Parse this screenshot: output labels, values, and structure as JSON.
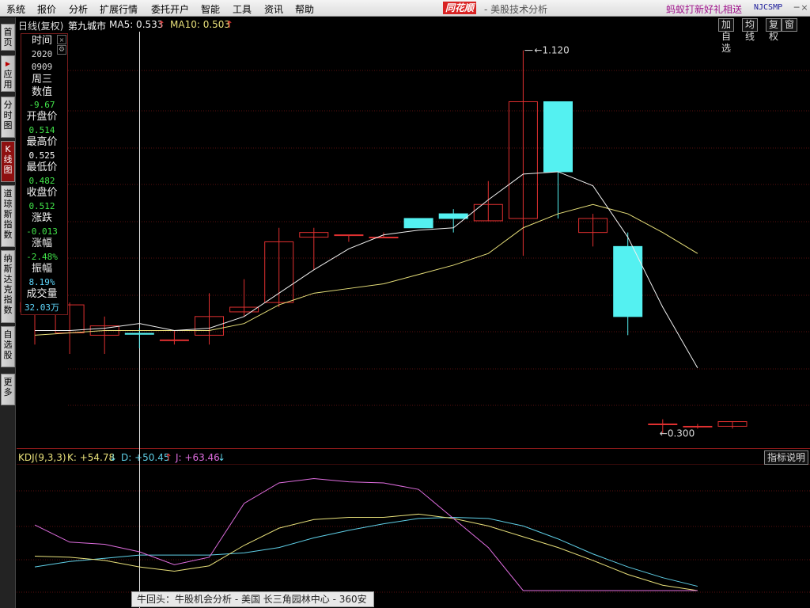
{
  "menu": [
    "系统",
    "报价",
    "分析",
    "扩展行情",
    "委托开户",
    "智能",
    "工具",
    "资讯",
    "帮助"
  ],
  "brand": {
    "logo_text": "同花顺",
    "title": "- 美股技术分析",
    "promo": "蚂蚁打新好礼相送",
    "user_id": "NJCSMP"
  },
  "window_buttons": [
    "─",
    "□",
    "×"
  ],
  "side_tabs": [
    {
      "label": "首页"
    },
    {
      "label": "应用"
    },
    {
      "label": "分时图"
    },
    {
      "label": "K线图"
    },
    {
      "label": "道琼斯指数"
    },
    {
      "label": "纳斯达克指数"
    },
    {
      "label": "自选股"
    },
    {
      "label": "更多"
    }
  ],
  "header": {
    "period": "日线(复权)",
    "stock_name": "第九城市",
    "ma5_label": "MA5: 0.533",
    "ma5_dir": "↑",
    "ma10_label": "MA10: 0.503",
    "ma10_dir": "↑",
    "buttons": [
      "加自选",
      "均线",
      "复权",
      "窗"
    ]
  },
  "info": {
    "time_label": "时间",
    "year": "2020",
    "date": "0909",
    "weekday": "周三",
    "value_label": "数值",
    "value": "-9.67",
    "open_label": "开盘价",
    "open": "0.514",
    "high_label": "最高价",
    "high": "0.525",
    "low_label": "最低价",
    "low": "0.482",
    "close_label": "收盘价",
    "close": "0.512",
    "change_label": "涨跌",
    "change": "-0.013",
    "pct_label": "涨幅",
    "pct": "-2.48%",
    "amp_label": "振幅",
    "amp": "8.19%",
    "vol_label": "成交量",
    "vol": "32.03万",
    "close_icon": "×",
    "gear_icon": "⚙"
  },
  "annotations": {
    "max_label": "1.120",
    "min_label": "0.300"
  },
  "kdj": {
    "name": "KDJ(9,3,3)",
    "k_label": "K: +54.78",
    "k_dir": "↓",
    "d_label": "D: +50.45",
    "d_dir": "↑",
    "j_label": "J: +63.46",
    "j_dir": "↓",
    "button": "指标说明"
  },
  "ticker": "牛回头：牛股机会分析 - 美国 长三角园林中心 - 360安",
  "colors": {
    "up": "#e03030",
    "down": "#54f1f1",
    "ma5": "#f0f0f0",
    "ma10": "#e8e07a",
    "k": "#e8e07a",
    "d": "#5fd0e8",
    "j": "#e06ee0",
    "grid": "#5a1010"
  },
  "chart_data": {
    "type": "candlestick",
    "price_ylim": [
      0.27,
      1.16
    ],
    "candles": [
      {
        "o": 0.56,
        "h": 0.6,
        "l": 0.49,
        "c": 0.58
      },
      {
        "o": 0.515,
        "h": 0.58,
        "l": 0.47,
        "c": 0.575
      },
      {
        "o": 0.51,
        "h": 0.55,
        "l": 0.47,
        "c": 0.53
      },
      {
        "o": 0.514,
        "h": 0.525,
        "l": 0.482,
        "c": 0.512
      },
      {
        "o": 0.5,
        "h": 0.52,
        "l": 0.49,
        "c": 0.5
      },
      {
        "o": 0.51,
        "h": 0.6,
        "l": 0.49,
        "c": 0.55
      },
      {
        "o": 0.56,
        "h": 0.63,
        "l": 0.55,
        "c": 0.57
      },
      {
        "o": 0.58,
        "h": 0.74,
        "l": 0.57,
        "c": 0.71
      },
      {
        "o": 0.72,
        "h": 0.74,
        "l": 0.65,
        "c": 0.73
      },
      {
        "o": 0.725,
        "h": 0.725,
        "l": 0.71,
        "c": 0.725
      },
      {
        "o": 0.72,
        "h": 0.73,
        "l": 0.72,
        "c": 0.72
      },
      {
        "o": 0.76,
        "h": 0.76,
        "l": 0.74,
        "c": 0.74
      },
      {
        "o": 0.77,
        "h": 0.78,
        "l": 0.73,
        "c": 0.76
      },
      {
        "o": 0.755,
        "h": 0.84,
        "l": 0.755,
        "c": 0.79
      },
      {
        "o": 0.76,
        "h": 1.12,
        "l": 0.68,
        "c": 1.01
      },
      {
        "o": 1.01,
        "h": 0.96,
        "l": 0.76,
        "c": 0.86
      },
      {
        "o": 0.73,
        "h": 0.77,
        "l": 0.7,
        "c": 0.76
      },
      {
        "o": 0.7,
        "h": 0.73,
        "l": 0.51,
        "c": 0.55
      },
      {
        "o": 0.32,
        "h": 0.33,
        "l": 0.3,
        "c": 0.32
      },
      {
        "o": 0.315,
        "h": 0.32,
        "l": 0.31,
        "c": 0.315
      },
      {
        "o": 0.315,
        "h": 0.325,
        "l": 0.31,
        "c": 0.325
      }
    ],
    "ma5": [
      0.52,
      0.52,
      0.525,
      0.535,
      0.52,
      0.525,
      0.55,
      0.6,
      0.65,
      0.695,
      0.725,
      0.735,
      0.74,
      0.8,
      0.855,
      0.86,
      0.83,
      0.72,
      0.57,
      0.44
    ],
    "ma10": [
      0.51,
      0.515,
      0.52,
      0.52,
      0.52,
      0.52,
      0.535,
      0.575,
      0.6,
      0.61,
      0.62,
      0.64,
      0.66,
      0.685,
      0.74,
      0.77,
      0.79,
      0.77,
      0.73,
      0.685
    ],
    "kdj_ylim": [
      0,
      100
    ],
    "k": [
      32,
      31,
      28,
      22,
      18,
      23,
      42,
      58,
      66,
      68,
      68,
      71,
      67,
      60,
      50,
      40,
      28,
      15,
      5,
      0
    ],
    "d": [
      22,
      27,
      30,
      33,
      33,
      33,
      35,
      40,
      49,
      56,
      62,
      67,
      68,
      67,
      60,
      48,
      34,
      22,
      12,
      4
    ],
    "j": [
      61,
      45,
      43,
      36,
      24,
      31,
      81,
      100,
      104,
      101,
      100,
      94,
      67,
      40,
      0,
      0,
      0,
      0,
      0,
      0
    ]
  }
}
